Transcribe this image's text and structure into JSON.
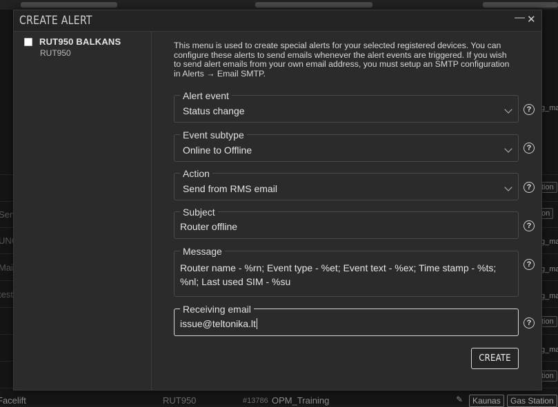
{
  "background": {
    "left_fragments": [
      "Serv",
      "UNC",
      "Mai",
      "test"
    ],
    "right_tags": [
      "tion",
      "on",
      "g_ma",
      "g_ma",
      "g_ma",
      "tion",
      "g_ma",
      "tion",
      "g_ma"
    ],
    "bottom_row": {
      "name": "Facelift",
      "model": "RUT950",
      "id": "#13786",
      "group": "OPM_Training",
      "tags": [
        "Kaunas",
        "Gas Station"
      ]
    }
  },
  "modal": {
    "title": "CREATE ALERT",
    "minimize_symbol": "—",
    "close_symbol": "✕",
    "device": {
      "name": "RUT950 BALKANS",
      "model": "RUT950",
      "checked": false
    },
    "intro": "This menu is used to create special alerts for your selected registered devices. You can configure these alerts to send emails whenever the alert events are triggered. If you wish to send alert emails from your own email address, you must setup an SMTP configuration in Alerts → Email SMTP.",
    "fields": {
      "alert_event": {
        "label": "Alert event",
        "value": "Status change"
      },
      "event_subtype": {
        "label": "Event subtype",
        "value": "Online to Offline"
      },
      "action": {
        "label": "Action",
        "value": "Send from RMS email"
      },
      "subject": {
        "label": "Subject",
        "value": "Router offline"
      },
      "message": {
        "label": "Message",
        "value": "Router name - %rn; Event type - %et; Event text - %ex; Time stamp - %ts; %nl; Last used SIM - %su"
      },
      "receiving_email": {
        "label": "Receiving email",
        "value": "issue@teltonika.lt"
      }
    },
    "help_symbol": "?",
    "create_label": "CREATE"
  }
}
